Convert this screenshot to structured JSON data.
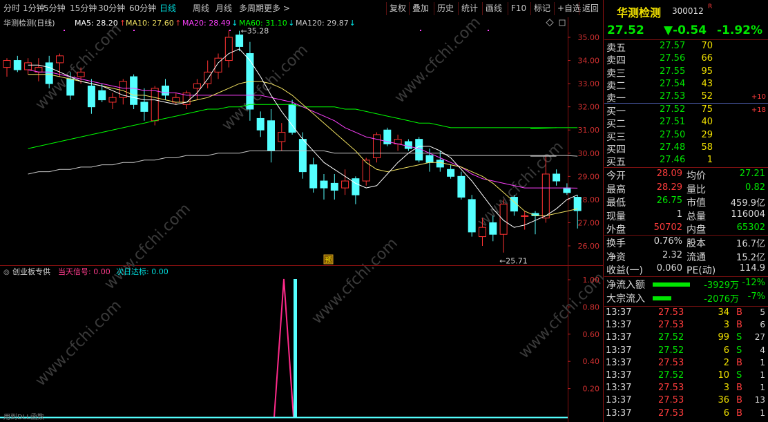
{
  "toolbar": {
    "periods": [
      "分时",
      "1分钟",
      "5分钟",
      "15分钟",
      "30分钟",
      "60分钟",
      "日线",
      "周线",
      "月线",
      "多周期",
      "更多"
    ],
    "active_period": "日线",
    "more_arrow": ">",
    "right_buttons": [
      "复权",
      "叠加",
      "历史",
      "统计",
      "画线",
      "F10",
      "标记",
      "+自选",
      "返回"
    ]
  },
  "main": {
    "stock_title": "华测检测(日线)",
    "ma_legend": [
      {
        "label": "MA5: 28.20",
        "arrow": "↑",
        "color": "#ffffff"
      },
      {
        "label": "MA10: 27.60",
        "arrow": "↑",
        "color": "#f0e060"
      },
      {
        "label": "MA20: 28.49",
        "arrow": "↓",
        "color": "#ff40ff"
      },
      {
        "label": "MA60: 31.10",
        "arrow": "↓",
        "color": "#00ff00"
      },
      {
        "label": "MA120: 29.87",
        "arrow": "↓",
        "color": "#c8c8c8"
      }
    ],
    "high_marker": "35.28",
    "low_marker": "25.71",
    "forecast_badge": "预",
    "price_axis": [
      "35.00",
      "34.00",
      "33.00",
      "32.00",
      "31.00",
      "30.00",
      "29.00",
      "28.00",
      "27.00",
      "26.00"
    ]
  },
  "indicator": {
    "title": "创业板专供",
    "signal_label": "当天信号: 0.00",
    "target_label": "次日达标: 0.00",
    "axis": [
      "1.00",
      "0.80",
      "0.60",
      "0.40",
      "0.20"
    ],
    "footer_note": "用到DLL函数"
  },
  "chart_data": {
    "type": "candlestick",
    "ylim": [
      25.5,
      35.6
    ],
    "candles": [
      {
        "o": 33.7,
        "h": 34.1,
        "l": 33.3,
        "c": 34.0
      },
      {
        "o": 34.0,
        "h": 34.2,
        "l": 33.5,
        "c": 33.6
      },
      {
        "o": 33.6,
        "h": 34.1,
        "l": 33.4,
        "c": 33.9
      },
      {
        "o": 33.5,
        "h": 34.1,
        "l": 33.1,
        "c": 33.7
      },
      {
        "o": 33.9,
        "h": 34.2,
        "l": 32.8,
        "c": 33.0
      },
      {
        "o": 33.9,
        "h": 34.3,
        "l": 33.3,
        "c": 34.2
      },
      {
        "o": 33.2,
        "h": 33.5,
        "l": 32.3,
        "c": 32.5
      },
      {
        "o": 33.3,
        "h": 33.7,
        "l": 33.0,
        "c": 33.5
      },
      {
        "o": 32.9,
        "h": 33.2,
        "l": 31.7,
        "c": 32.0
      },
      {
        "o": 32.7,
        "h": 33.0,
        "l": 32.2,
        "c": 32.3
      },
      {
        "o": 32.2,
        "h": 32.6,
        "l": 31.9,
        "c": 32.4
      },
      {
        "o": 32.4,
        "h": 33.2,
        "l": 32.1,
        "c": 33.1
      },
      {
        "o": 33.3,
        "h": 33.4,
        "l": 31.9,
        "c": 32.1
      },
      {
        "o": 32.2,
        "h": 32.8,
        "l": 31.4,
        "c": 31.8
      },
      {
        "o": 31.4,
        "h": 32.9,
        "l": 31.2,
        "c": 32.8
      },
      {
        "o": 32.9,
        "h": 33.2,
        "l": 32.3,
        "c": 32.5
      },
      {
        "o": 32.2,
        "h": 32.6,
        "l": 32.1,
        "c": 32.4
      },
      {
        "o": 32.1,
        "h": 32.7,
        "l": 31.9,
        "c": 32.6
      },
      {
        "o": 32.8,
        "h": 33.2,
        "l": 32.3,
        "c": 33.0
      },
      {
        "o": 33.0,
        "h": 34.0,
        "l": 32.8,
        "c": 33.5
      },
      {
        "o": 33.5,
        "h": 34.3,
        "l": 33.2,
        "c": 34.1
      },
      {
        "o": 34.0,
        "h": 35.3,
        "l": 33.7,
        "c": 35.0
      },
      {
        "o": 35.1,
        "h": 35.28,
        "l": 34.4,
        "c": 34.6
      },
      {
        "o": 34.3,
        "h": 34.8,
        "l": 31.4,
        "c": 31.9
      },
      {
        "o": 31.5,
        "h": 31.8,
        "l": 30.7,
        "c": 31.0
      },
      {
        "o": 31.4,
        "h": 31.9,
        "l": 29.6,
        "c": 30.1
      },
      {
        "o": 30.5,
        "h": 31.3,
        "l": 30.1,
        "c": 30.9
      },
      {
        "o": 32.1,
        "h": 32.3,
        "l": 30.8,
        "c": 30.9
      },
      {
        "o": 30.6,
        "h": 30.9,
        "l": 28.9,
        "c": 29.2
      },
      {
        "o": 29.5,
        "h": 29.8,
        "l": 28.3,
        "c": 28.5
      },
      {
        "o": 28.8,
        "h": 29.1,
        "l": 28.0,
        "c": 28.5
      },
      {
        "o": 28.7,
        "h": 29.1,
        "l": 28.0,
        "c": 28.4
      },
      {
        "o": 28.5,
        "h": 29.3,
        "l": 28.2,
        "c": 28.8
      },
      {
        "o": 28.9,
        "h": 29.0,
        "l": 27.8,
        "c": 28.2
      },
      {
        "o": 28.8,
        "h": 29.8,
        "l": 28.6,
        "c": 29.7
      },
      {
        "o": 29.8,
        "h": 30.9,
        "l": 29.6,
        "c": 30.8
      },
      {
        "o": 31.0,
        "h": 31.1,
        "l": 30.3,
        "c": 30.4
      },
      {
        "o": 30.4,
        "h": 30.8,
        "l": 30.1,
        "c": 30.6
      },
      {
        "o": 30.5,
        "h": 30.6,
        "l": 30.1,
        "c": 30.2
      },
      {
        "o": 30.6,
        "h": 30.7,
        "l": 29.6,
        "c": 29.7
      },
      {
        "o": 29.9,
        "h": 30.2,
        "l": 29.2,
        "c": 29.6
      },
      {
        "o": 29.7,
        "h": 30.1,
        "l": 29.2,
        "c": 29.4
      },
      {
        "o": 29.3,
        "h": 29.5,
        "l": 28.9,
        "c": 29.0
      },
      {
        "o": 29.0,
        "h": 29.2,
        "l": 28.0,
        "c": 28.1
      },
      {
        "o": 28.0,
        "h": 28.2,
        "l": 26.4,
        "c": 26.6
      },
      {
        "o": 26.4,
        "h": 27.2,
        "l": 26.0,
        "c": 26.8
      },
      {
        "o": 27.0,
        "h": 27.3,
        "l": 26.2,
        "c": 26.5
      },
      {
        "o": 26.5,
        "h": 28.0,
        "l": 25.71,
        "c": 27.8
      },
      {
        "o": 28.1,
        "h": 28.2,
        "l": 27.3,
        "c": 27.5
      },
      {
        "o": 27.3,
        "h": 27.5,
        "l": 26.7,
        "c": 27.3
      },
      {
        "o": 27.4,
        "h": 27.5,
        "l": 26.5,
        "c": 27.3
      },
      {
        "o": 27.2,
        "h": 29.9,
        "l": 27.0,
        "c": 29.1
      },
      {
        "o": 29.1,
        "h": 29.3,
        "l": 28.6,
        "c": 28.8
      },
      {
        "o": 28.5,
        "h": 28.7,
        "l": 28.2,
        "c": 28.3
      },
      {
        "o": 28.1,
        "h": 28.2,
        "l": 26.75,
        "c": 27.52
      }
    ],
    "ma5": [
      33.8,
      33.8,
      33.7,
      33.5,
      33.3,
      33.1,
      33.0,
      32.9,
      32.7,
      32.5,
      32.4,
      32.3,
      32.3,
      32.2,
      32.1,
      32.2,
      32.6,
      33.2,
      33.9,
      34.3,
      34.5,
      34.0,
      33.3,
      32.5,
      31.8,
      31.2,
      30.6,
      30.1,
      29.6,
      29.3,
      29.0,
      28.7,
      28.5,
      28.6,
      29.1,
      29.6,
      30.0,
      30.3,
      30.3,
      30.1,
      29.8,
      29.3,
      28.8,
      28.2,
      27.6,
      27.1,
      26.8,
      26.9,
      27.1,
      27.3,
      27.6,
      28.0,
      28.2
    ],
    "ma10": [
      33.4,
      33.4,
      33.4,
      33.3,
      33.2,
      33.1,
      33.0,
      32.9,
      32.8,
      32.7,
      32.5,
      32.5,
      32.4,
      32.3,
      32.2,
      32.2,
      32.3,
      32.4,
      32.6,
      32.8,
      33.0,
      33.1,
      33.1,
      33.0,
      32.8,
      32.5,
      32.1,
      31.7,
      31.3,
      30.9,
      30.5,
      30.1,
      29.6,
      29.3,
      29.2,
      29.3,
      29.4,
      29.5,
      29.6,
      29.6,
      29.5,
      29.4,
      29.2,
      29.0,
      28.7,
      28.3,
      27.9,
      27.5,
      27.3,
      27.3,
      27.4,
      27.5,
      27.6
    ],
    "ma20": [
      33.6,
      33.5,
      33.5,
      33.4,
      33.3,
      33.2,
      33.1,
      33.0,
      32.9,
      32.8,
      32.8,
      32.7,
      32.7,
      32.6,
      32.6,
      32.5,
      32.5,
      32.5,
      32.5,
      32.5,
      32.5,
      32.5,
      32.5,
      32.4,
      32.3,
      32.2,
      32.0,
      31.8,
      31.6,
      31.4,
      31.1,
      30.9,
      30.7,
      30.6,
      30.5,
      30.4,
      30.3,
      30.2,
      30.0,
      29.8,
      29.6,
      29.4,
      29.1,
      28.9,
      28.8,
      28.7,
      28.6,
      28.5,
      28.5,
      28.5,
      28.5,
      28.5,
      28.49
    ],
    "ma60": [
      30.2,
      30.3,
      30.4,
      30.5,
      30.6,
      30.7,
      30.8,
      30.9,
      31.0,
      31.1,
      31.2,
      31.3,
      31.4,
      31.5,
      31.6,
      31.7,
      31.8,
      31.9,
      31.9,
      32.0,
      32.0,
      32.1,
      32.1,
      32.1,
      32.1,
      32.1,
      32.0,
      32.0,
      32.0,
      32.0,
      31.9,
      31.9,
      31.8,
      31.7,
      31.6,
      31.5,
      31.4,
      31.3,
      31.3,
      31.2,
      31.1,
      31.1,
      31.1,
      31.1,
      31.1,
      31.1,
      31.1,
      31.1,
      31.1,
      31.1,
      31.1,
      31.1,
      31.1
    ],
    "ma120": [
      29.1,
      29.2,
      29.2,
      29.3,
      29.3,
      29.4,
      29.4,
      29.5,
      29.5,
      29.6,
      29.6,
      29.7,
      29.7,
      29.8,
      29.8,
      29.9,
      29.9,
      29.9,
      30.0,
      30.0,
      30.0,
      30.1,
      30.1,
      30.1,
      30.1,
      30.1,
      30.1,
      30.1,
      30.1,
      30.0,
      30.0,
      30.0,
      30.0,
      30.0,
      30.0,
      30.0,
      30.0,
      30.0,
      30.0,
      30.0,
      29.9,
      29.9,
      29.9,
      29.9,
      29.9,
      29.9,
      29.9,
      29.9,
      29.9,
      29.9,
      29.9,
      29.9,
      29.87
    ]
  },
  "quote": {
    "name": "华测检测",
    "code": "300012",
    "mark": "R",
    "price": "27.52",
    "change": "▼-0.54",
    "change_pct": "-1.92%",
    "sells": [
      {
        "label": "卖五",
        "price": "27.57",
        "vol": "70",
        "delta": ""
      },
      {
        "label": "卖四",
        "price": "27.56",
        "vol": "66",
        "delta": ""
      },
      {
        "label": "卖三",
        "price": "27.55",
        "vol": "95",
        "delta": ""
      },
      {
        "label": "卖二",
        "price": "27.54",
        "vol": "43",
        "delta": ""
      },
      {
        "label": "卖一",
        "price": "27.53",
        "vol": "52",
        "delta": "+10"
      }
    ],
    "buys": [
      {
        "label": "买一",
        "price": "27.52",
        "vol": "75",
        "delta": "+18"
      },
      {
        "label": "买二",
        "price": "27.51",
        "vol": "40",
        "delta": ""
      },
      {
        "label": "买三",
        "price": "27.50",
        "vol": "29",
        "delta": ""
      },
      {
        "label": "买四",
        "price": "27.48",
        "vol": "58",
        "delta": ""
      },
      {
        "label": "买五",
        "price": "27.46",
        "vol": "1",
        "delta": ""
      }
    ],
    "stats": [
      {
        "l1": "今开",
        "v1": "28.09",
        "c1": "r",
        "l2": "均价",
        "v2": "27.21",
        "c2": "g"
      },
      {
        "l1": "最高",
        "v1": "28.29",
        "c1": "r",
        "l2": "量比",
        "v2": "0.82",
        "c2": "g"
      },
      {
        "l1": "最低",
        "v1": "26.75",
        "c1": "g",
        "l2": "市值",
        "v2": "459.9亿",
        "c2": "w"
      },
      {
        "l1": "现量",
        "v1": "1",
        "c1": "w",
        "l2": "总量",
        "v2": "116004",
        "c2": "w"
      },
      {
        "l1": "外盘",
        "v1": "50702",
        "c1": "r",
        "l2": "内盘",
        "v2": "65302",
        "c2": "g"
      }
    ],
    "fin": [
      {
        "l1": "换手",
        "v1": "0.76%",
        "l2": "股本",
        "v2": "16.7亿"
      },
      {
        "l1": "净资",
        "v1": "2.32",
        "l2": "流通",
        "v2": "15.2亿"
      },
      {
        "l1": "收益(一)",
        "v1": "0.060",
        "l2": "PE(动)",
        "v2": "114.9"
      }
    ],
    "flows": [
      {
        "label": "净流入额",
        "amount": "-3929万",
        "pct": "-12%",
        "bar": 1.0
      },
      {
        "label": "大宗流入",
        "amount": "-2076万",
        "pct": "-7%",
        "bar": 0.5
      }
    ],
    "trades": [
      {
        "time": "13:37",
        "price": "27.53",
        "vol": "34",
        "side": "B",
        "n": "5"
      },
      {
        "time": "13:37",
        "price": "27.53",
        "vol": "3",
        "side": "B",
        "n": "6"
      },
      {
        "time": "13:37",
        "price": "27.52",
        "vol": "99",
        "side": "S",
        "n": "27"
      },
      {
        "time": "13:37",
        "price": "27.52",
        "vol": "6",
        "side": "S",
        "n": "4"
      },
      {
        "time": "13:37",
        "price": "27.53",
        "vol": "2",
        "side": "B",
        "n": "1"
      },
      {
        "time": "13:37",
        "price": "27.52",
        "vol": "10",
        "side": "S",
        "n": "1"
      },
      {
        "time": "13:37",
        "price": "27.53",
        "vol": "3",
        "side": "B",
        "n": "1"
      },
      {
        "time": "13:37",
        "price": "27.53",
        "vol": "36",
        "side": "B",
        "n": "13"
      },
      {
        "time": "13:37",
        "price": "27.53",
        "vol": "6",
        "side": "B",
        "n": "1"
      }
    ]
  },
  "watermark": "www.cfchi.com"
}
